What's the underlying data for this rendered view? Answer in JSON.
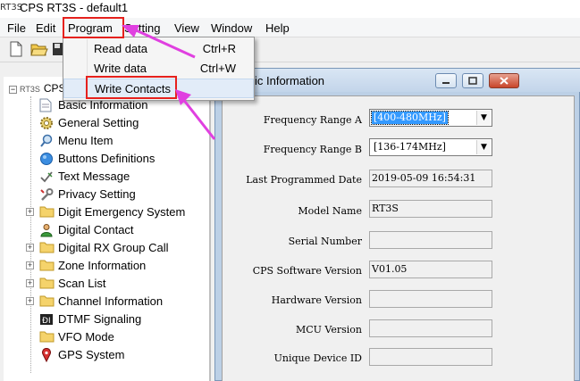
{
  "window": {
    "icon_text": "RT3S",
    "title": "CPS RT3S - default1"
  },
  "menubar": {
    "items": [
      {
        "label": "File"
      },
      {
        "label": "Edit"
      },
      {
        "label": "Program"
      },
      {
        "label": "Setting"
      },
      {
        "label": "View"
      },
      {
        "label": "Window"
      },
      {
        "label": "Help"
      }
    ]
  },
  "program_menu": {
    "items": [
      {
        "label": "Read data",
        "shortcut": "Ctrl+R"
      },
      {
        "label": "Write data",
        "shortcut": "Ctrl+W"
      },
      {
        "label": "Write Contacts",
        "shortcut": ""
      }
    ]
  },
  "tree": {
    "root_label": "CPS",
    "root_icon_text": "RT3S",
    "items": [
      {
        "label": "Basic Information",
        "icon": "page-icon",
        "expandable": false
      },
      {
        "label": "General Setting",
        "icon": "gear-icon",
        "expandable": false
      },
      {
        "label": "Menu Item",
        "icon": "magnifier-icon",
        "expandable": false
      },
      {
        "label": "Buttons Definitions",
        "icon": "blue-circle-icon",
        "expandable": false
      },
      {
        "label": "Text Message",
        "icon": "check-pen-icon",
        "expandable": false
      },
      {
        "label": "Privacy Setting",
        "icon": "wrench-icon",
        "expandable": false
      },
      {
        "label": "Digit Emergency System",
        "icon": "folder-icon",
        "expandable": true
      },
      {
        "label": "Digital Contact",
        "icon": "person-icon",
        "expandable": false
      },
      {
        "label": "Digital RX Group Call",
        "icon": "folder-icon",
        "expandable": true
      },
      {
        "label": "Zone Information",
        "icon": "folder-icon",
        "expandable": true
      },
      {
        "label": "Scan List",
        "icon": "folder-icon",
        "expandable": true
      },
      {
        "label": "Channel Information",
        "icon": "folder-icon",
        "expandable": true
      },
      {
        "label": "DTMF Signaling",
        "icon": "dtmf-icon",
        "expandable": false
      },
      {
        "label": "VFO Mode",
        "icon": "folder-icon",
        "expandable": false
      },
      {
        "label": "GPS System",
        "icon": "gps-pin-icon",
        "expandable": false
      }
    ]
  },
  "child_window": {
    "title": "ic Information"
  },
  "basic_info": {
    "freq_range_a": {
      "label": "Frequency Range A",
      "value": "[400-480MHz]"
    },
    "freq_range_b": {
      "label": "Frequency Range B",
      "value": "[136-174MHz]"
    },
    "last_programmed": {
      "label": "Last Programmed Date",
      "value": "2019-05-09 16:54:31"
    },
    "model_name": {
      "label": "Model Name",
      "value": "RT3S"
    },
    "serial_number": {
      "label": "Serial Number",
      "value": ""
    },
    "cps_version": {
      "label": "CPS Software Version",
      "value": "V01.05"
    },
    "hardware_version": {
      "label": "Hardware Version",
      "value": ""
    },
    "mcu_version": {
      "label": "MCU Version",
      "value": ""
    },
    "unique_device_id": {
      "label": "Unique Device ID",
      "value": ""
    }
  },
  "colors": {
    "annotation_red": "#e6211d",
    "annotation_arrow": "#e040e0",
    "selection_blue": "#3399ff"
  }
}
